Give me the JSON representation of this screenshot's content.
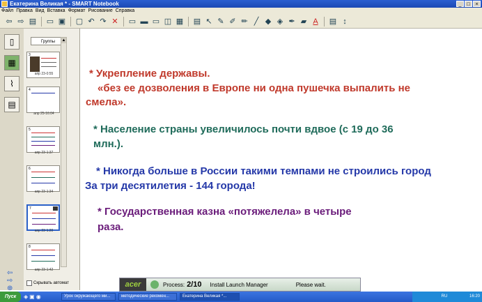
{
  "window": {
    "title": "Екатерина Великая * - SMART Notebook",
    "btn_min": "_",
    "btn_max": "□",
    "btn_close": "×"
  },
  "menu": [
    "Файл",
    "Правка",
    "Вид",
    "Вставка",
    "Формат",
    "Рисование",
    "Справка"
  ],
  "pages_panel": {
    "group_button": "Группы",
    "thumbs": [
      {
        "num": "3",
        "label": "апр 23-0:55"
      },
      {
        "num": "4",
        "label": "апр 25-16:04"
      },
      {
        "num": "5",
        "label": "апр 23-1:37"
      },
      {
        "num": "6",
        "label": "апр 23-1:34"
      },
      {
        "num": "7",
        "label": "апр 23-1:20"
      },
      {
        "num": "8",
        "label": "апр 23-1:42"
      }
    ],
    "autohide_label": "Скрывать автомат"
  },
  "slide": {
    "l1": "* Укрепление державы.",
    "l2": "«без ее дозволения в Европе ни одна пушечка выпалить не",
    "l3": "смела».",
    "l4": "* Население страны увеличилось почти вдвое (с 19 до 36",
    "l5": "млн.).",
    "l6": "* Никогда больше в России такими темпами не строились город",
    "l7": "За три десятилетия - 144 города!",
    "l8": "* Государственная казна «потяжелела» в четыре",
    "l9": "раза."
  },
  "acer_popup": {
    "logo": "acer",
    "process_label": "Process:",
    "process_value": "2/10",
    "task": "Install Launch Manager",
    "wait": "Please wait."
  },
  "taskbar": {
    "start": "Пуск",
    "items": [
      "Урок окружающего ми...",
      "методические рекомен...",
      "Екатерина Великая *..."
    ],
    "tray_lang": "RU",
    "clock": "16:20"
  }
}
